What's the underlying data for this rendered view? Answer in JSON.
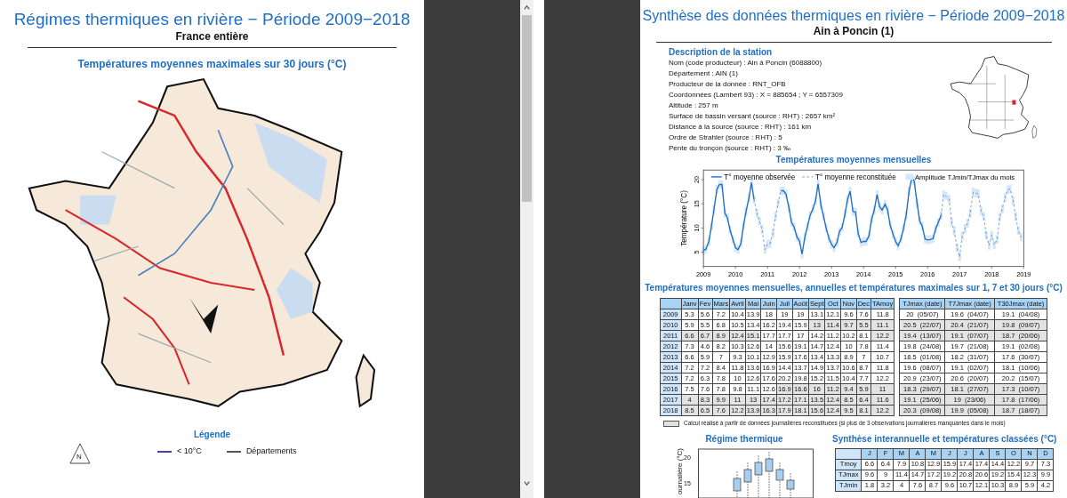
{
  "left_page": {
    "title": "Régimes thermiques en rivière − Période 2009−2018",
    "subtitle": "France entière",
    "map_title": "Températures moyennes maximales sur 30 jours (°C)",
    "legend": {
      "title": "Légende",
      "north_label": "N",
      "items": [
        {
          "label": "< 10°C",
          "color": "#4b3fa8"
        },
        {
          "label": "Départements",
          "color": "#555555"
        }
      ]
    }
  },
  "right_page": {
    "title": "Synthèse des données thermiques en rivière − Période 2009−2018",
    "subtitle": "Ain à Poncin (1)",
    "description": {
      "title": "Description de la station",
      "lines": [
        "Nom (code producteur) : Ain à Poncin (6088800)",
        "Département : AIN (1)",
        "Producteur de la donnée : RNT_OFB",
        "Coordonnées (Lambert 93) : X = 885654 ; Y = 6557309",
        "Altitude : 257 m",
        "Surface de bassin versant (source : RHT) : 2657 km²",
        "Distance à la source (source : RHT) : 161 km",
        "Ordre de Strahler (source : RHT) : 5",
        "Pente du tronçon (source : RHT) : 3 ‰"
      ]
    },
    "chart": {
      "title": "Températures moyennes mensuelles",
      "band_label": "Amplitude TJmin/TJmax du mois",
      "chart_data": {
        "type": "line",
        "ylabel": "Température (°C)",
        "xlim": [
          2009,
          2019
        ],
        "ylim": [
          2,
          22
        ],
        "yticks": [
          5,
          10,
          15,
          20
        ],
        "xticks": [
          2009,
          2010,
          2011,
          2012,
          2013,
          2014,
          2015,
          2016,
          2017,
          2018,
          2019
        ],
        "x": [
          2009,
          2009.08,
          2009.17,
          2009.25,
          2009.33,
          2009.42,
          2009.5,
          2009.58,
          2009.67,
          2009.75,
          2009.83,
          2009.92,
          2010,
          2010.08,
          2010.17,
          2010.25,
          2010.33,
          2010.42,
          2010.5,
          2010.58,
          2010.67,
          2010.75,
          2010.83,
          2010.92,
          2011,
          2011.08,
          2011.17,
          2011.25,
          2011.33,
          2011.42,
          2011.5,
          2011.58,
          2011.67,
          2011.75,
          2011.83,
          2011.92,
          2012,
          2012.08,
          2012.17,
          2012.25,
          2012.33,
          2012.42,
          2012.5,
          2012.58,
          2012.67,
          2012.75,
          2012.83,
          2012.92,
          2013,
          2013.08,
          2013.17,
          2013.25,
          2013.33,
          2013.42,
          2013.5,
          2013.58,
          2013.67,
          2013.75,
          2013.83,
          2013.92,
          2014,
          2014.08,
          2014.17,
          2014.25,
          2014.33,
          2014.42,
          2014.5,
          2014.58,
          2014.67,
          2014.75,
          2014.83,
          2014.92,
          2015,
          2015.08,
          2015.17,
          2015.25,
          2015.33,
          2015.42,
          2015.5,
          2015.58,
          2015.67,
          2015.75,
          2015.83,
          2015.92,
          2016,
          2016.08,
          2016.17,
          2016.25,
          2016.33,
          2016.42,
          2016.5,
          2016.58,
          2016.67,
          2016.75,
          2016.83,
          2016.92,
          2017,
          2017.08,
          2017.17,
          2017.25,
          2017.33,
          2017.42,
          2017.5,
          2017.58,
          2017.67,
          2017.75,
          2017.83,
          2017.92,
          2018,
          2018.08,
          2018.17,
          2018.25,
          2018.33,
          2018.42,
          2018.5,
          2018.58,
          2018.67,
          2018.75,
          2018.83,
          2018.92
        ],
        "legend": true,
        "series": [
          {
            "name": "T° moyenne observée",
            "color": "#1f6fc5",
            "line_style": "solid",
            "errors": [
              0.9,
              0.9,
              0.9,
              0.9,
              0.9,
              0.9,
              0.9,
              0.9,
              0.9,
              0.9,
              0.9,
              0.9,
              0.9,
              0.9,
              0.9,
              0.9,
              0.9,
              0.9,
              0.9,
              0.9,
              null,
              null,
              null,
              null,
              null,
              null,
              null,
              null,
              null,
              0.9,
              0.9,
              0.9,
              0.9,
              0.9,
              0.9,
              0.9,
              0.9,
              0.9,
              0.9,
              0.9,
              0.9,
              0.9,
              0.9,
              0.9,
              0.9,
              0.9,
              0.9,
              0.9,
              0.9,
              0.9,
              0.9,
              0.9,
              0.9,
              0.9,
              0.9,
              0.9,
              0.9,
              0.9,
              0.9,
              0.9,
              0.9,
              0.9,
              0.9,
              0.9,
              0.9,
              0.9,
              0.9,
              0.9,
              0.9,
              0.9,
              0.9,
              0.9,
              0.9,
              0.9,
              0.9,
              0.9,
              0.9,
              0.9,
              0.9,
              0.9,
              0.9,
              0.9,
              0.9,
              0.9,
              0.9,
              0.9,
              0.9,
              0.9,
              0.9,
              0.9,
              null,
              null,
              null,
              null,
              null,
              null,
              null,
              null,
              null,
              null,
              null,
              null,
              null,
              null,
              null,
              null,
              null,
              null,
              null,
              null,
              null,
              null,
              null,
              null,
              null,
              null,
              null,
              null,
              null,
              null
            ],
            "values": [
              5.3,
              5.6,
              7.2,
              10.4,
              13.9,
              18,
              19,
              19,
              13.1,
              12.1,
              9.6,
              7.6,
              5.9,
              5.5,
              6.8,
              10.5,
              13.4,
              16.2,
              19.4,
              15.9,
              null,
              null,
              null,
              null,
              null,
              null,
              null,
              null,
              null,
              17.7,
              17.7,
              17,
              14.2,
              11.2,
              10.2,
              8.1,
              7.3,
              4.6,
              8.2,
              10.3,
              12.6,
              14,
              15.6,
              19.1,
              14.7,
              12.4,
              10,
              7.8,
              6.6,
              5.9,
              7,
              9.3,
              10.1,
              12.9,
              15.9,
              17.6,
              13.4,
              13.3,
              8.9,
              7,
              7.2,
              7.2,
              8.4,
              11.8,
              13.6,
              16.9,
              14.4,
              13.7,
              14.9,
              13.7,
              10.6,
              8.7,
              7.2,
              6.3,
              7.8,
              10,
              12.6,
              17.6,
              20.2,
              19.8,
              15.2,
              11.5,
              10.4,
              7.7,
              7.5,
              7.6,
              7.8,
              9.8,
              11.1,
              12.6,
              null,
              null,
              null,
              null,
              null,
              null,
              null,
              null,
              null,
              null,
              null,
              null,
              null,
              null,
              null,
              null,
              null,
              null,
              null,
              null,
              null,
              null,
              null,
              null,
              null,
              null,
              null,
              null,
              null,
              null
            ]
          },
          {
            "name": "T° moyenne reconstituée",
            "color": "#5b8fd0",
            "line_style": "dashed",
            "errors": [
              null,
              null,
              null,
              null,
              null,
              null,
              null,
              null,
              null,
              null,
              null,
              null,
              null,
              null,
              null,
              null,
              null,
              null,
              null,
              null,
              0.9,
              0.9,
              0.9,
              0.9,
              0.9,
              0.9,
              0.9,
              0.9,
              0.9,
              null,
              null,
              null,
              null,
              null,
              null,
              null,
              null,
              null,
              null,
              null,
              null,
              null,
              null,
              null,
              null,
              null,
              null,
              null,
              null,
              null,
              null,
              null,
              null,
              null,
              null,
              null,
              null,
              null,
              null,
              null,
              null,
              null,
              null,
              null,
              null,
              null,
              null,
              null,
              null,
              null,
              null,
              null,
              null,
              null,
              null,
              null,
              null,
              null,
              null,
              null,
              null,
              null,
              null,
              null,
              null,
              null,
              null,
              null,
              null,
              null,
              0.9,
              0.9,
              0.9,
              0.9,
              0.9,
              0.9,
              0.9,
              0.9,
              0.9,
              0.9,
              0.9,
              0.9,
              0.9,
              0.9,
              0.9,
              0.9,
              0.9,
              0.9,
              0.9,
              0.9,
              0.9,
              0.9,
              0.9,
              0.9,
              0.9,
              0.9,
              0.9,
              0.9,
              0.9,
              0.9
            ],
            "values": [
              null,
              null,
              null,
              null,
              null,
              null,
              null,
              null,
              null,
              null,
              null,
              null,
              null,
              null,
              null,
              null,
              null,
              null,
              null,
              15.9,
              13,
              11.4,
              9.7,
              5.5,
              6.6,
              6.7,
              8.9,
              12.4,
              15.1,
              17.7,
              null,
              null,
              null,
              null,
              null,
              null,
              null,
              null,
              null,
              null,
              null,
              null,
              null,
              null,
              null,
              null,
              null,
              null,
              null,
              null,
              null,
              null,
              null,
              null,
              null,
              null,
              null,
              null,
              null,
              null,
              null,
              null,
              null,
              null,
              null,
              null,
              null,
              null,
              null,
              null,
              null,
              null,
              null,
              null,
              null,
              null,
              null,
              null,
              null,
              null,
              null,
              null,
              null,
              null,
              null,
              null,
              null,
              null,
              null,
              12.6,
              16.9,
              16.6,
              16,
              11.2,
              9.4,
              5.9,
              4,
              8.3,
              9.9,
              11,
              13,
              17.4,
              17.2,
              17.1,
              13.5,
              12.4,
              8.5,
              6.4,
              8.5,
              6.5,
              7.6,
              12.2,
              13.9,
              16.3,
              17.9,
              18.1,
              15.6,
              12.4,
              9.5,
              8.1
            ]
          }
        ]
      }
    },
    "monthly_table": {
      "title": "Températures moyennes mensuelles, annuelles et températures maximales sur 1, 7 et 30 jours (°C)",
      "columns": [
        "Janv",
        "Fev",
        "Mars",
        "Avril",
        "Mai",
        "Juin",
        "Juil",
        "Août",
        "Sept",
        "Oct",
        "Nov",
        "Dec",
        "TAmoy"
      ],
      "rows": [
        {
          "year": "2009",
          "cells": [
            "5.3",
            "5.6",
            "7.2",
            "10.4",
            "13.9",
            "18",
            "19",
            "19",
            "13.1",
            "12.1",
            "9.6",
            "7.6",
            "11.8"
          ],
          "reconstructed": [
            false,
            false,
            false,
            false,
            false,
            false,
            false,
            false,
            false,
            false,
            false,
            false,
            false
          ]
        },
        {
          "year": "2010",
          "cells": [
            "5.9",
            "5.5",
            "6.8",
            "10.5",
            "13.4",
            "16.2",
            "19.4",
            "15.9",
            "13",
            "11.4",
            "9.7",
            "5.5",
            "11.1"
          ],
          "reconstructed": [
            false,
            false,
            false,
            false,
            false,
            false,
            false,
            false,
            true,
            true,
            true,
            true,
            true
          ]
        },
        {
          "year": "2011",
          "cells": [
            "6.6",
            "6.7",
            "8.9",
            "12.4",
            "15.1",
            "17.7",
            "17.7",
            "17",
            "14.2",
            "11.2",
            "10.2",
            "8.1",
            "12.2"
          ],
          "reconstructed": [
            true,
            true,
            true,
            true,
            true,
            false,
            false,
            false,
            false,
            false,
            false,
            false,
            true
          ]
        },
        {
          "year": "2012",
          "cells": [
            "7.3",
            "4.6",
            "8.2",
            "10.3",
            "12.6",
            "14",
            "15.6",
            "19.1",
            "14.7",
            "12.4",
            "10",
            "7.8",
            "11.4"
          ],
          "reconstructed": [
            false,
            false,
            false,
            false,
            false,
            false,
            false,
            false,
            false,
            false,
            false,
            false,
            false
          ]
        },
        {
          "year": "2013",
          "cells": [
            "6.6",
            "5.9",
            "7",
            "9.3",
            "10.1",
            "12.9",
            "15.9",
            "17.6",
            "13.4",
            "13.3",
            "8.9",
            "7",
            "10.7"
          ],
          "reconstructed": [
            false,
            false,
            false,
            false,
            false,
            false,
            false,
            false,
            false,
            false,
            false,
            false,
            false
          ]
        },
        {
          "year": "2014",
          "cells": [
            "7.2",
            "7.2",
            "8.4",
            "11.8",
            "13.6",
            "16.9",
            "14.4",
            "13.7",
            "14.9",
            "13.7",
            "10.6",
            "8.7",
            "11.8"
          ],
          "reconstructed": [
            false,
            false,
            false,
            false,
            false,
            false,
            false,
            false,
            false,
            false,
            false,
            false,
            false
          ]
        },
        {
          "year": "2015",
          "cells": [
            "7.2",
            "6.3",
            "7.8",
            "10",
            "12.6",
            "17.6",
            "20.2",
            "19.8",
            "15.2",
            "11.5",
            "10.4",
            "7.7",
            "12.2"
          ],
          "reconstructed": [
            false,
            false,
            false,
            false,
            false,
            false,
            false,
            false,
            false,
            false,
            false,
            false,
            false
          ]
        },
        {
          "year": "2016",
          "cells": [
            "7.5",
            "7.6",
            "7.8",
            "9.8",
            "11.1",
            "12.6",
            "16.9",
            "16.6",
            "16",
            "11.2",
            "9.4",
            "5.9",
            "11"
          ],
          "reconstructed": [
            false,
            false,
            false,
            false,
            false,
            false,
            true,
            true,
            true,
            true,
            true,
            true,
            true
          ]
        },
        {
          "year": "2017",
          "cells": [
            "4",
            "8.3",
            "9.9",
            "11",
            "13",
            "17.4",
            "17.2",
            "17.1",
            "13.5",
            "12.4",
            "8.5",
            "6.4",
            "11.6"
          ],
          "reconstructed": [
            true,
            true,
            true,
            true,
            true,
            true,
            true,
            true,
            true,
            true,
            true,
            true,
            true
          ]
        },
        {
          "year": "2018",
          "cells": [
            "8.5",
            "6.5",
            "7.6",
            "12.2",
            "13.9",
            "16.3",
            "17.9",
            "18.1",
            "15.6",
            "12.4",
            "9.5",
            "8.1",
            "12.2"
          ],
          "reconstructed": [
            true,
            true,
            true,
            true,
            true,
            true,
            true,
            true,
            true,
            true,
            true,
            true,
            true
          ]
        }
      ]
    },
    "max_table": {
      "columns": [
        "TJmax (date)",
        "T7Jmax (date)",
        "T30Jmax (date)"
      ],
      "rows": [
        {
          "cells": [
            "20  (05/07)",
            "19.6  (04/07)",
            "19.1  (04/08)"
          ],
          "shaded": false
        },
        {
          "cells": [
            "20.5  (22/07)",
            "20.4  (21/07)",
            "19.8  (09/07)"
          ],
          "shaded": true
        },
        {
          "cells": [
            "19.4  (13/07)",
            "19.1  (07/07)",
            "18.7  (20/06)"
          ],
          "shaded": true
        },
        {
          "cells": [
            "19.8  (24/08)",
            "19.7  (21/08)",
            "19.1  (02/08)"
          ],
          "shaded": false
        },
        {
          "cells": [
            "18.5  (01/08)",
            "18.2  (31/07)",
            "17.6  (30/07)"
          ],
          "shaded": false
        },
        {
          "cells": [
            "19.6  (08/07)",
            "19.1  (02/07)",
            "18.1  (10/06)"
          ],
          "shaded": false
        },
        {
          "cells": [
            "20.9  (23/07)",
            "20.6  (20/07)",
            "20.2  (15/07)"
          ],
          "shaded": false
        },
        {
          "cells": [
            "18.3  (29/07)",
            "18.1  (27/07)",
            "17.3  (10/07)"
          ],
          "shaded": true
        },
        {
          "cells": [
            "19.1  (25/06)",
            "19  (23/06)",
            "17.8  (17/06)"
          ],
          "shaded": true
        },
        {
          "cells": [
            "20.3  (09/08)",
            "19.9  (05/08)",
            "18.7  (18/07)"
          ],
          "shaded": true
        }
      ]
    },
    "footnote": "Calcul réalisé à partir de données journalières reconstituées (si plus de 3 observations journalières manquantes dans le mois)",
    "regime": {
      "title": "Régime thermique",
      "ylabel": "ournalière (°C)",
      "yticks": [
        "20",
        "15"
      ]
    },
    "synthesis": {
      "title": "Synthèse interannuelle et températures classées (°C)",
      "columns": [
        "J",
        "F",
        "M",
        "A",
        "M",
        "J",
        "J",
        "A",
        "S",
        "O",
        "N",
        "D"
      ],
      "rows": [
        {
          "label": "Tmoy",
          "cells": [
            "6.6",
            "6.4",
            "7.9",
            "10.8",
            "12.9",
            "15.9",
            "17.4",
            "17.4",
            "14.4",
            "12.2",
            "9.7",
            "7.3"
          ]
        },
        {
          "label": "TJmax",
          "cells": [
            "9.6",
            "9",
            "11.4",
            "14.7",
            "17.2",
            "19.2",
            "20.8",
            "20.6",
            "19.2",
            "15.4",
            "12.3",
            "9.9"
          ]
        },
        {
          "label": "TJmin",
          "cells": [
            "1.8",
            "3.2",
            "4",
            "7.6",
            "8.7",
            "9.6",
            "10.7",
            "12.1",
            "10.3",
            "8.9",
            "5.9",
            "4.2"
          ]
        }
      ]
    }
  }
}
